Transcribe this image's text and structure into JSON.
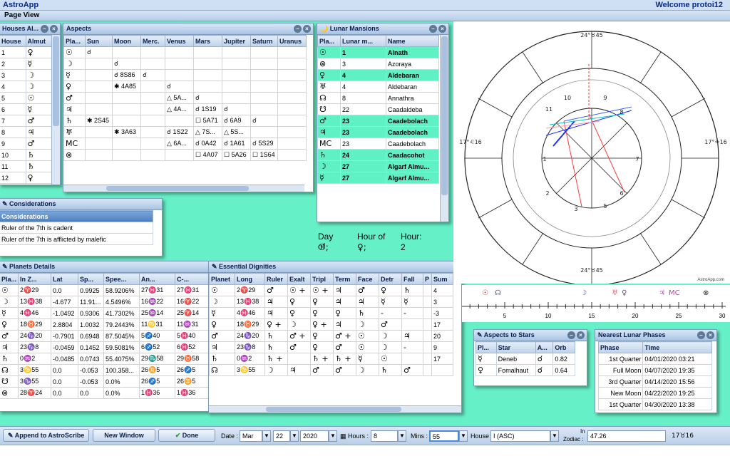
{
  "app": {
    "title": "AstroApp",
    "welcome": "Welcome protoi12",
    "page_view": "Page View"
  },
  "houses": {
    "title": "Houses Al...",
    "headers": [
      "House",
      "Almut"
    ],
    "rows": [
      [
        "1",
        "♀"
      ],
      [
        "2",
        "☿"
      ],
      [
        "3",
        "☽"
      ],
      [
        "4",
        "☽"
      ],
      [
        "5",
        "☉"
      ],
      [
        "6",
        "☿"
      ],
      [
        "7",
        "♂"
      ],
      [
        "8",
        "♃"
      ],
      [
        "9",
        "♂"
      ],
      [
        "10",
        "♄"
      ],
      [
        "11",
        "♄"
      ],
      [
        "12",
        "♀"
      ]
    ]
  },
  "aspects": {
    "title": "Aspects",
    "headers": [
      "Pla...",
      "Sun",
      "Moon",
      "Merc.",
      "Venus",
      "Mars",
      "Jupiter",
      "Saturn",
      "Uranus"
    ],
    "rows": [
      [
        "☉",
        "☌",
        "",
        "",
        "",
        "",
        "",
        "",
        ""
      ],
      [
        "☽",
        "",
        "☌",
        "",
        "",
        "",
        "",
        "",
        ""
      ],
      [
        "☿",
        "",
        "☌ 8S86",
        "☌",
        "",
        "",
        "",
        "",
        ""
      ],
      [
        "♀",
        "",
        "✱ 4A85",
        "",
        "☌",
        "",
        "",
        "",
        ""
      ],
      [
        "♂",
        "",
        "",
        "",
        "△ 5A...",
        "☌",
        "",
        "",
        ""
      ],
      [
        "♃",
        "",
        "",
        "",
        "△ 4A...",
        "☌ 1S19",
        "☌",
        "",
        ""
      ],
      [
        "♄",
        "✱ 2S45",
        "",
        "",
        "",
        "☐ 5A71",
        "☌ 6A9",
        "☌",
        ""
      ],
      [
        "♅",
        "",
        "✱ 3A63",
        "",
        "☌ 1S22",
        "△ 7S...",
        "△ 5S...",
        "",
        ""
      ],
      [
        "MC",
        "",
        "",
        "",
        "△ 6A...",
        "☌ 0A42",
        "☌ 1A61",
        "☌ 5S29",
        ""
      ],
      [
        "⊗",
        "",
        "",
        "",
        "",
        "☐ 4A07",
        "☐ 5A26",
        "☐ 1S64",
        ""
      ]
    ]
  },
  "lunar": {
    "title": "Lunar Mansions",
    "headers": [
      "Pla...",
      "Lunar m...",
      "Name"
    ],
    "rows": [
      {
        "p": "☉",
        "n": "1",
        "name": "Alnath",
        "hl": true
      },
      {
        "p": "⊗",
        "n": "3",
        "name": "Azoraya",
        "hl": false
      },
      {
        "p": "♀",
        "n": "4",
        "name": "Aldebaran",
        "hl": true
      },
      {
        "p": "♅",
        "n": "4",
        "name": "Aldebaran",
        "hl": false
      },
      {
        "p": "☊",
        "n": "8",
        "name": "Annathra",
        "hl": false
      },
      {
        "p": "☋",
        "n": "22",
        "name": "Caadaldeba",
        "hl": false
      },
      {
        "p": "♂",
        "n": "23",
        "name": "Caadebolach",
        "hl": true
      },
      {
        "p": "♃",
        "n": "23",
        "name": "Caadebolach",
        "hl": true
      },
      {
        "p": "MC",
        "n": "23",
        "name": "Caadebolach",
        "hl": false
      },
      {
        "p": "♄",
        "n": "24",
        "name": "Caadacohot",
        "hl": true
      },
      {
        "p": "☽",
        "n": "27",
        "name": "Algarf Almu...",
        "hl": true
      },
      {
        "p": "☿",
        "n": "27",
        "name": "Algarf Almu...",
        "hl": true
      }
    ]
  },
  "dayhour": {
    "day_label": "Day of",
    "day_sym": "☉;",
    "hour_of_label": "Hour of",
    "hour_of_sym": "♀;",
    "hour_label": "Hour:",
    "hour_val": "2"
  },
  "considerations": {
    "title": "Considerations",
    "header": "Considerations",
    "rows": [
      "Ruler of the 7th is cadent",
      "Ruler of the 7th is afflicted by malefic"
    ]
  },
  "planets": {
    "title": "Planets Details",
    "headers": [
      "Pla...",
      "In Z...",
      "Lat",
      "Sp...",
      "Spee...",
      "An...",
      "C-..."
    ],
    "rows": [
      [
        "☉",
        "2♈29",
        "0.0",
        "0.9925",
        "58.9206%",
        "27♓31",
        "27♓31"
      ],
      [
        "☽",
        "13♓38",
        "-4.677",
        "11.91...",
        "4.5496%",
        "16♒22",
        "16♈22"
      ],
      [
        "☿",
        "4♓46",
        "-1.0492",
        "0.9306",
        "41.7302%",
        "25♒14",
        "25♈14"
      ],
      [
        "♀",
        "18♉29",
        "2.8804",
        "1.0032",
        "79.2443%",
        "11♋31",
        "11♒31"
      ],
      [
        "♂",
        "24♑20",
        "-0.7901",
        "0.6948",
        "87.5045%",
        "5♐40",
        "5♓40"
      ],
      [
        "♃",
        "23♑8",
        "-0.0459",
        "0.1452",
        "59.5081%",
        "6♐52",
        "6♓52"
      ],
      [
        "♄",
        "0♒2",
        "-0.0485",
        "0.0743",
        "55.4075%",
        "29♏58",
        "29♉58"
      ],
      [
        "☊",
        "3♋55",
        "0.0",
        "-0.053",
        "100.358...",
        "26♊5",
        "26♐5"
      ],
      [
        "☋",
        "3♑55",
        "0.0",
        "-0.053",
        "0.0%",
        "26♐5",
        "26♊5"
      ],
      [
        "⊗",
        "28♈24",
        "0.0",
        "0.0",
        "0.0%",
        "1♓36",
        "1♓36"
      ]
    ]
  },
  "dignities": {
    "title": "Essential Dignities",
    "headers": [
      "Planet",
      "Long",
      "Ruler",
      "Exalt",
      "Tripl",
      "Term",
      "Face",
      "Detr",
      "Fall",
      "P",
      "Sum"
    ],
    "rows": [
      [
        "☉",
        "2♈29",
        "♂",
        "☉ +",
        "☉ +",
        "♃",
        "♂",
        "♀",
        "♄",
        "",
        "4"
      ],
      [
        "☽",
        "13♓38",
        "♃",
        "♀",
        "♀",
        "♃",
        "♃",
        "☿",
        "☿",
        "",
        "3"
      ],
      [
        "☿",
        "4♓46",
        "♃",
        "♀",
        "♀",
        "♀",
        "♄",
        "-",
        "-",
        "",
        "-3"
      ],
      [
        "♀",
        "18♉29",
        "♀ +",
        "☽",
        "♀ +",
        "♃",
        "☽",
        "♂",
        "",
        "",
        "17"
      ],
      [
        "♂",
        "24♑20",
        "♄",
        "♂ +",
        "♀",
        "♂ +",
        "☉",
        "☽",
        "♃",
        "",
        "20"
      ],
      [
        "♃",
        "23♑8",
        "♄",
        "♂",
        "♀",
        "♂",
        "☉",
        "☽",
        "-",
        "",
        "9"
      ],
      [
        "♄",
        "0♒2",
        "♄ +",
        "",
        "♄ +",
        "♄ +",
        "☿",
        "☉",
        "",
        "",
        "17"
      ],
      [
        "☊",
        "3♋55",
        "☽",
        "♃",
        "♂",
        "♂",
        "☽",
        "♄",
        "♂",
        "",
        ""
      ]
    ]
  },
  "aspects_stars": {
    "title": "Aspects to Stars",
    "headers": [
      "Pl...",
      "Star",
      "A...",
      "Orb"
    ],
    "rows": [
      [
        "☿",
        "Deneb",
        "☌",
        "0.82"
      ],
      [
        "♀",
        "Fomalhaut",
        "☌",
        "0.64"
      ]
    ]
  },
  "lunar_phases": {
    "title": "Nearest Lunar Phases",
    "headers": [
      "Phase",
      "Time"
    ],
    "rows": [
      [
        "1st Quarter",
        "04/01/2020 03:21"
      ],
      [
        "Full Moon",
        "04/07/2020 19:35"
      ],
      [
        "3rd Quarter",
        "04/14/2020 15:56"
      ],
      [
        "New Moon",
        "04/22/2020 19:25"
      ],
      [
        "1st Quarter",
        "04/30/2020 13:38"
      ]
    ]
  },
  "ruler": {
    "ticks": [
      "5",
      "10",
      "15",
      "20",
      "25",
      "30"
    ],
    "copyright": "AstroApp.com"
  },
  "wheel": {
    "cusps": [
      {
        "label": "24°♉45",
        "pos": "top"
      },
      {
        "label": "24°♉45",
        "pos": "bottom"
      },
      {
        "label": "17°♌16",
        "pos": "left"
      },
      {
        "label": "17°♒16",
        "pos": "right"
      }
    ],
    "house_numbers": [
      "1",
      "2",
      "3",
      "4",
      "5",
      "6",
      "7",
      "8",
      "9",
      "10",
      "11",
      "12"
    ]
  },
  "bottom": {
    "append": "Append to AstroScribe",
    "new_window": "New Window",
    "done": "Done",
    "date_label": "Date :",
    "month": "Mar",
    "day": "22",
    "year": "2020",
    "hours_label": "Hours :",
    "hours": "8",
    "mins_label": "Mins :",
    "mins": "55",
    "house_label": "House :",
    "house": "I (ASC)",
    "zodiac_label_1": "In",
    "zodiac_label_2": "Zodiac :",
    "zodiac": "47.26",
    "zodiac_result": "17♉16"
  },
  "colors": {
    "bg": "#66f0c8",
    "highlight": "#5ff0c4",
    "header": "#a9c3e3"
  }
}
